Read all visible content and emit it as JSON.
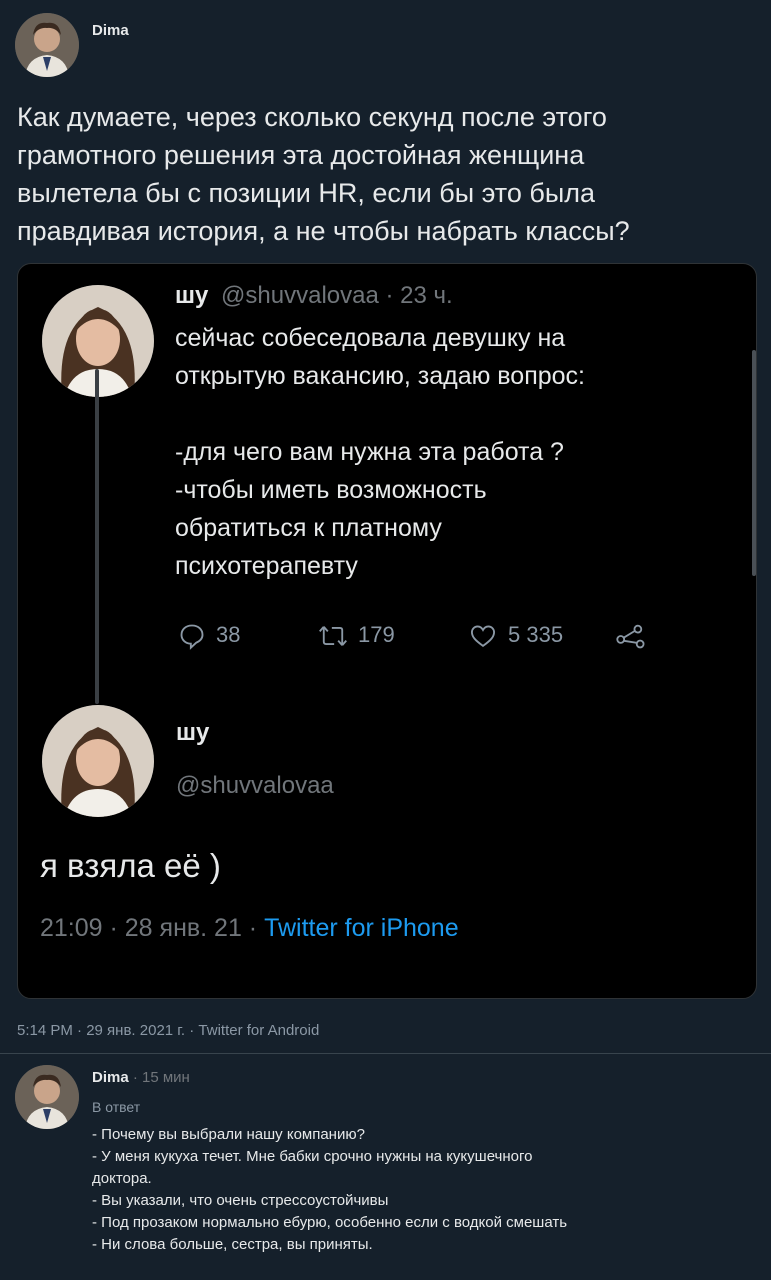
{
  "tweet": {
    "author": "Dima",
    "text": "Как думаете, через сколько секунд после этого\nграмотного решения эта достойная женщина\nвылетела бы с позиции HR, если бы это была\nправдивая история, а не чтобы набрать классы?",
    "meta": "5:14 PM · 29 янв. 2021 г. · Twitter for Android"
  },
  "quoted": {
    "name": "шу",
    "handle": "@shuvvalovaa",
    "sep": " · ",
    "time": "23 ч.",
    "text": "сейчас собеседовала девушку на\nоткрытую вакансию, задаю вопрос:\n\n-для чего вам нужна эта работа ?\n-чтобы иметь возможность\nобратиться к платному\nпсихотерапевту",
    "replies": "38",
    "retweets": "179",
    "likes": "5 335",
    "reply_name": "шу",
    "reply_handle": "@shuvvalovaa",
    "reply_text": "я взяла её )",
    "reply_meta": "21:09 · 28 янв. 21 · ",
    "reply_source": "Twitter for iPhone"
  },
  "reply": {
    "author": "Dima",
    "time": " · 15 мин",
    "label": "В ответ",
    "text": "- Почему вы выбрали нашу компанию?\n- У меня кукуха течет. Мне бабки срочно нужны на кукушечного\nдоктора.\n- Вы указали, что очень стрессоустойчивы\n- Под прозаком нормально ебурю, особенно если с водкой смешать\n- Ни слова больше, сестра, вы приняты."
  },
  "icons": [
    "avatar",
    "comment-icon",
    "retweet-icon",
    "like-icon",
    "share-icon"
  ],
  "colors": {
    "background": "#15202b",
    "card": "#000000",
    "link": "#1d9bf0",
    "muted": "#71767b"
  }
}
